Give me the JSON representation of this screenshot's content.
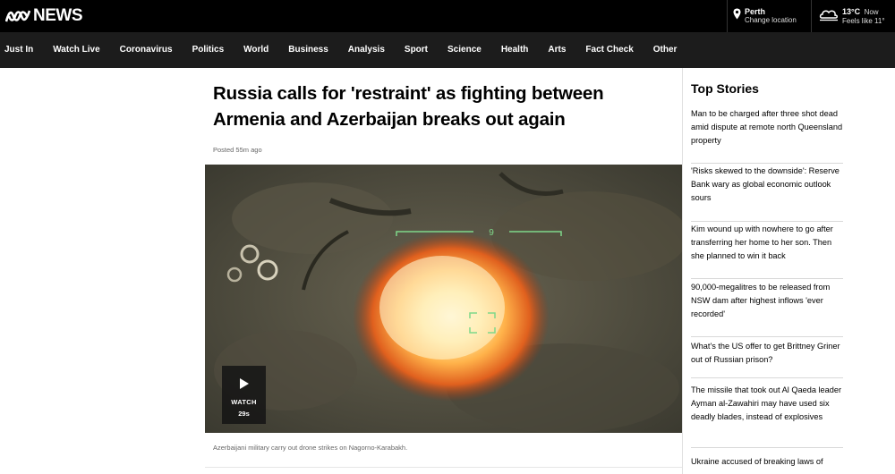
{
  "header": {
    "logo_text": "NEWS",
    "location": {
      "icon": "location-pin-icon",
      "city": "Perth",
      "action": "Change location"
    },
    "weather": {
      "icon": "partly-cloudy-icon",
      "temp": "13°C",
      "now": "Now",
      "feels": "Feels like 11°"
    }
  },
  "nav": {
    "items": [
      {
        "label": "Just In"
      },
      {
        "label": "Watch Live"
      },
      {
        "label": "Coronavirus"
      },
      {
        "label": "Politics"
      },
      {
        "label": "World"
      },
      {
        "label": "Business"
      },
      {
        "label": "Analysis"
      },
      {
        "label": "Sport"
      },
      {
        "label": "Science"
      },
      {
        "label": "Health"
      },
      {
        "label": "Arts"
      },
      {
        "label": "Fact Check"
      },
      {
        "label": "Other"
      }
    ]
  },
  "article": {
    "headline": "Russia calls for 'restraint' as fighting between Armenia and Azerbaijan breaks out again",
    "posted": "Posted 55m ago",
    "video": {
      "watch_label": "WATCH",
      "duration": "29s",
      "hud_number": "9"
    },
    "caption": "Azerbaijani military carry out drone strikes on Nagorno-Karabakh."
  },
  "sidebar": {
    "title": "Top Stories",
    "stories": [
      {
        "text": "Man to be charged after three shot dead amid dispute at remote north Queensland property"
      },
      {
        "text": "'Risks skewed to the downside': Reserve Bank wary as global economic outlook sours"
      },
      {
        "text": "Kim wound up with nowhere to go after transferring her home to her son. Then she planned to win it back"
      },
      {
        "text": "90,000-megalitres to be released from NSW dam after highest inflows 'ever recorded'"
      },
      {
        "text": "What's the US offer to get Brittney Griner out of Russian prison?"
      },
      {
        "text": "The missile that took out Al Qaeda leader Ayman al-Zawahiri may have used six deadly blades, instead of explosives"
      },
      {
        "text": "Ukraine accused of breaking laws of"
      }
    ]
  },
  "colors": {
    "topbar": "#000000",
    "navbar": "#1c1c1c",
    "hud": "#7fd88a"
  }
}
